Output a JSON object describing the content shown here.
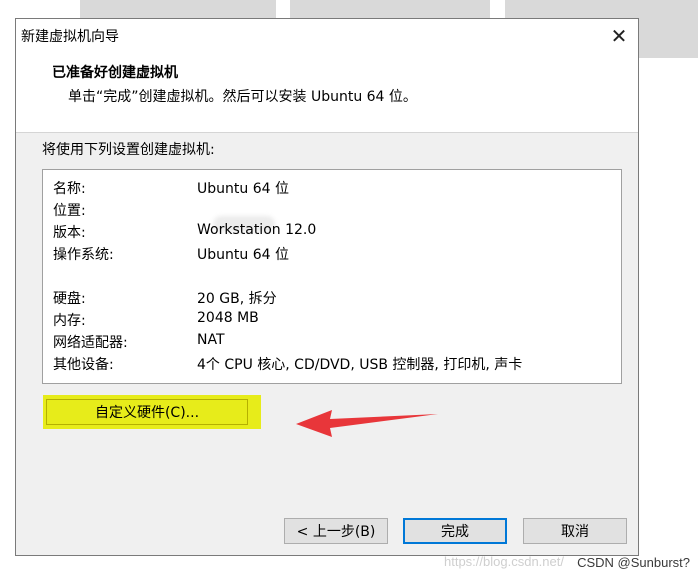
{
  "window": {
    "title": "新建虚拟机向导"
  },
  "header": {
    "title": "已准备好创建虚拟机",
    "subtitle": "单击“完成”创建虚拟机。然后可以安装 Ubuntu 64 位。"
  },
  "intro": "将使用下列设置创建虚拟机:",
  "summary": [
    {
      "label": "名称:",
      "value": "Ubuntu 64 位"
    },
    {
      "label": "位置:",
      "value": ""
    },
    {
      "label": "版本:",
      "value": "Workstation 12.0"
    },
    {
      "label": "操作系统:",
      "value": "Ubuntu 64 位"
    },
    {
      "label": "硬盘:",
      "value": "20 GB, 拆分"
    },
    {
      "label": "内存:",
      "value": "2048 MB"
    },
    {
      "label": "网络适配器:",
      "value": "NAT"
    },
    {
      "label": "其他设备:",
      "value": "4个 CPU 核心, CD/DVD, USB 控制器, 打印机, 声卡"
    }
  ],
  "buttons": {
    "customize": "自定义硬件(C)...",
    "back": "< 上一步(B)",
    "finish": "完成",
    "cancel": "取消"
  },
  "watermark": {
    "faint": "https://blog.csdn.net/",
    "text": "CSDN @Sunburst?"
  },
  "colors": {
    "highlight": "#e6eb0e",
    "arrow": "#e8363a",
    "accent": "#0078d7"
  },
  "icons": {
    "close": "close-icon",
    "annotation": "red-arrow-icon"
  }
}
